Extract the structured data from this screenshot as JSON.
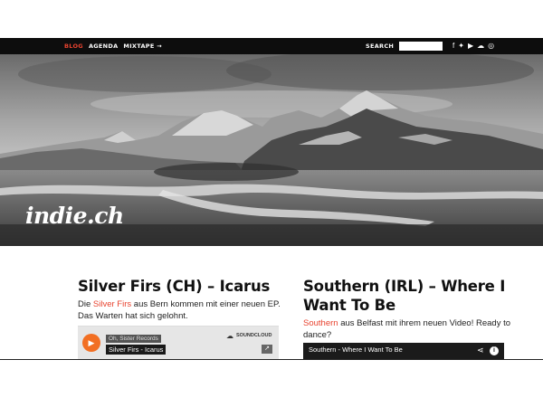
{
  "nav": {
    "items": [
      {
        "label": "BLOG",
        "active": true
      },
      {
        "label": "AGENDA",
        "active": false
      },
      {
        "label": "MIXTAPE →",
        "active": false
      }
    ],
    "search_label": "SEARCH",
    "search_value": "",
    "social_icons": [
      "facebook-icon",
      "twitter-icon",
      "youtube-icon",
      "soundcloud-icon",
      "rss-icon"
    ],
    "icon_glyphs": [
      "f",
      "✦",
      "▶",
      "☁",
      "◎"
    ],
    "accent_color": "#e8432f"
  },
  "hero": {
    "logo": "indie.ch"
  },
  "posts": [
    {
      "title": "Silver Firs (CH) – Icarus",
      "text_pre": "Die ",
      "text_link": "Silver Firs",
      "text_post": " aus Bern kommen mit einer neuen EP. Das Warten hat sich gelohnt."
    },
    {
      "title": "Southern (IRL) – Where I Want To Be",
      "text_pre": "",
      "text_link": "Southern",
      "text_post": " aus Belfast mit ihrem neuen Video! Ready to dance?"
    }
  ],
  "soundcloud": {
    "label": "Oh, Sister Records",
    "track": "Silver Firs - Icarus",
    "brand": "SOUNDCLOUD"
  },
  "video": {
    "title": "Southern - Where I Want To Be"
  }
}
